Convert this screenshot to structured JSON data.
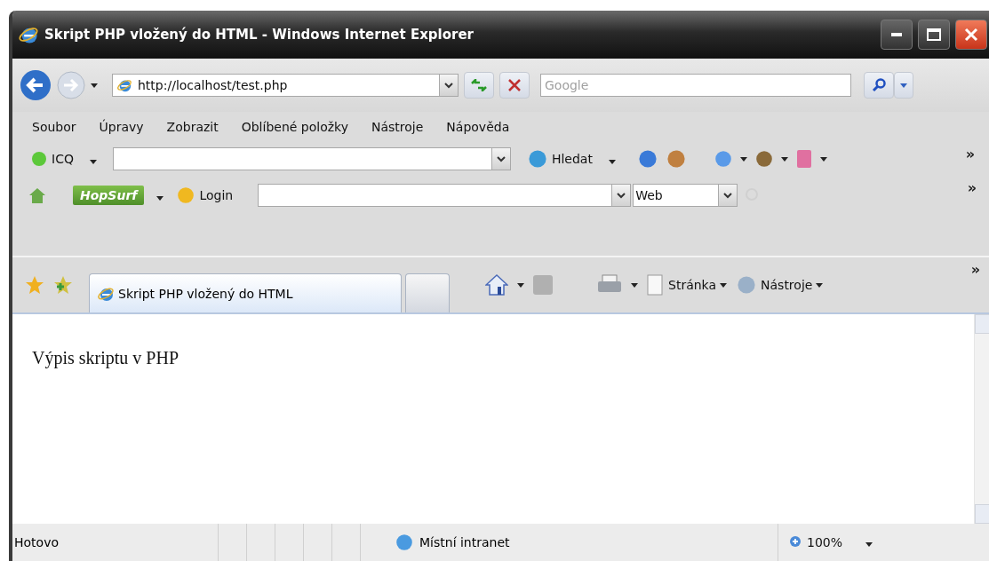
{
  "window": {
    "title": "Skript PHP vložený do HTML - Windows Internet Explorer"
  },
  "address_bar": {
    "value": "http://localhost/test.php"
  },
  "search": {
    "placeholder": "Google"
  },
  "menu": [
    "Soubor",
    "Úpravy",
    "Zobrazit",
    "Oblíbené položky",
    "Nástroje",
    "Nápověda"
  ],
  "icq_toolbar": {
    "label": "ICQ",
    "search_button": "Hledat",
    "overflow": "»"
  },
  "hopsurf_toolbar": {
    "logo": "HopSurf",
    "login": "Login",
    "engine": "Web",
    "overflow": "»"
  },
  "tabs": [
    {
      "label": "Skript PHP vložený do HTML",
      "selected": true
    }
  ],
  "command_bar": {
    "page": "Stránka",
    "tools": "Nástroje",
    "overflow": "»"
  },
  "content": {
    "text": "Výpis skriptu v PHP"
  },
  "status_bar": {
    "status": "Hotovo",
    "zone": "Místní intranet",
    "zoom": "100%"
  }
}
